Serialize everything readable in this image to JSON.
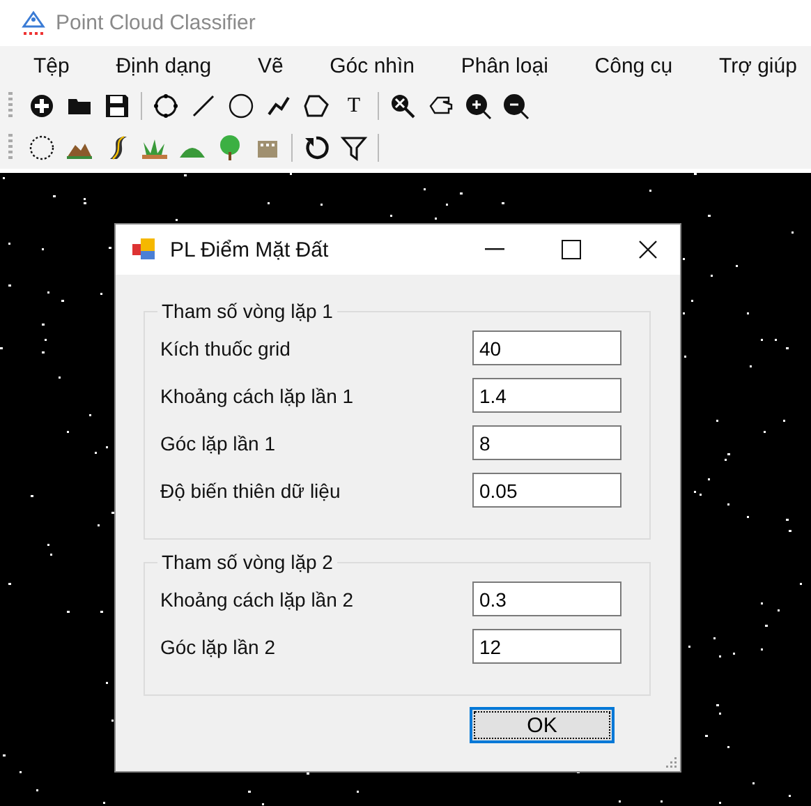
{
  "window": {
    "title": "Point Cloud Classifier"
  },
  "menu": [
    "Tệp",
    "Định dạng",
    "Vẽ",
    "Góc nhìn",
    "Phân loại",
    "Công cụ",
    "Trợ giúp"
  ],
  "toolbar": {
    "text_tool": "T"
  },
  "dialog": {
    "title": "PL Điểm Mặt Đất",
    "groups": [
      {
        "title": "Tham số vòng lặp 1",
        "fields": [
          {
            "label": "Kích thuốc grid",
            "value": "40"
          },
          {
            "label": "Khoảng cách lặp lần 1",
            "value": "1.4"
          },
          {
            "label": "Góc lặp lần 1",
            "value": "8"
          },
          {
            "label": "Độ biến thiên dữ liệu",
            "value": "0.05"
          }
        ]
      },
      {
        "title": "Tham số vòng lặp 2",
        "fields": [
          {
            "label": "Khoảng cách lặp lần 2",
            "value": "0.3"
          },
          {
            "label": "Góc lặp lần 2",
            "value": "12"
          }
        ]
      }
    ],
    "ok_button": {
      "label": "OK",
      "focused": true
    }
  }
}
